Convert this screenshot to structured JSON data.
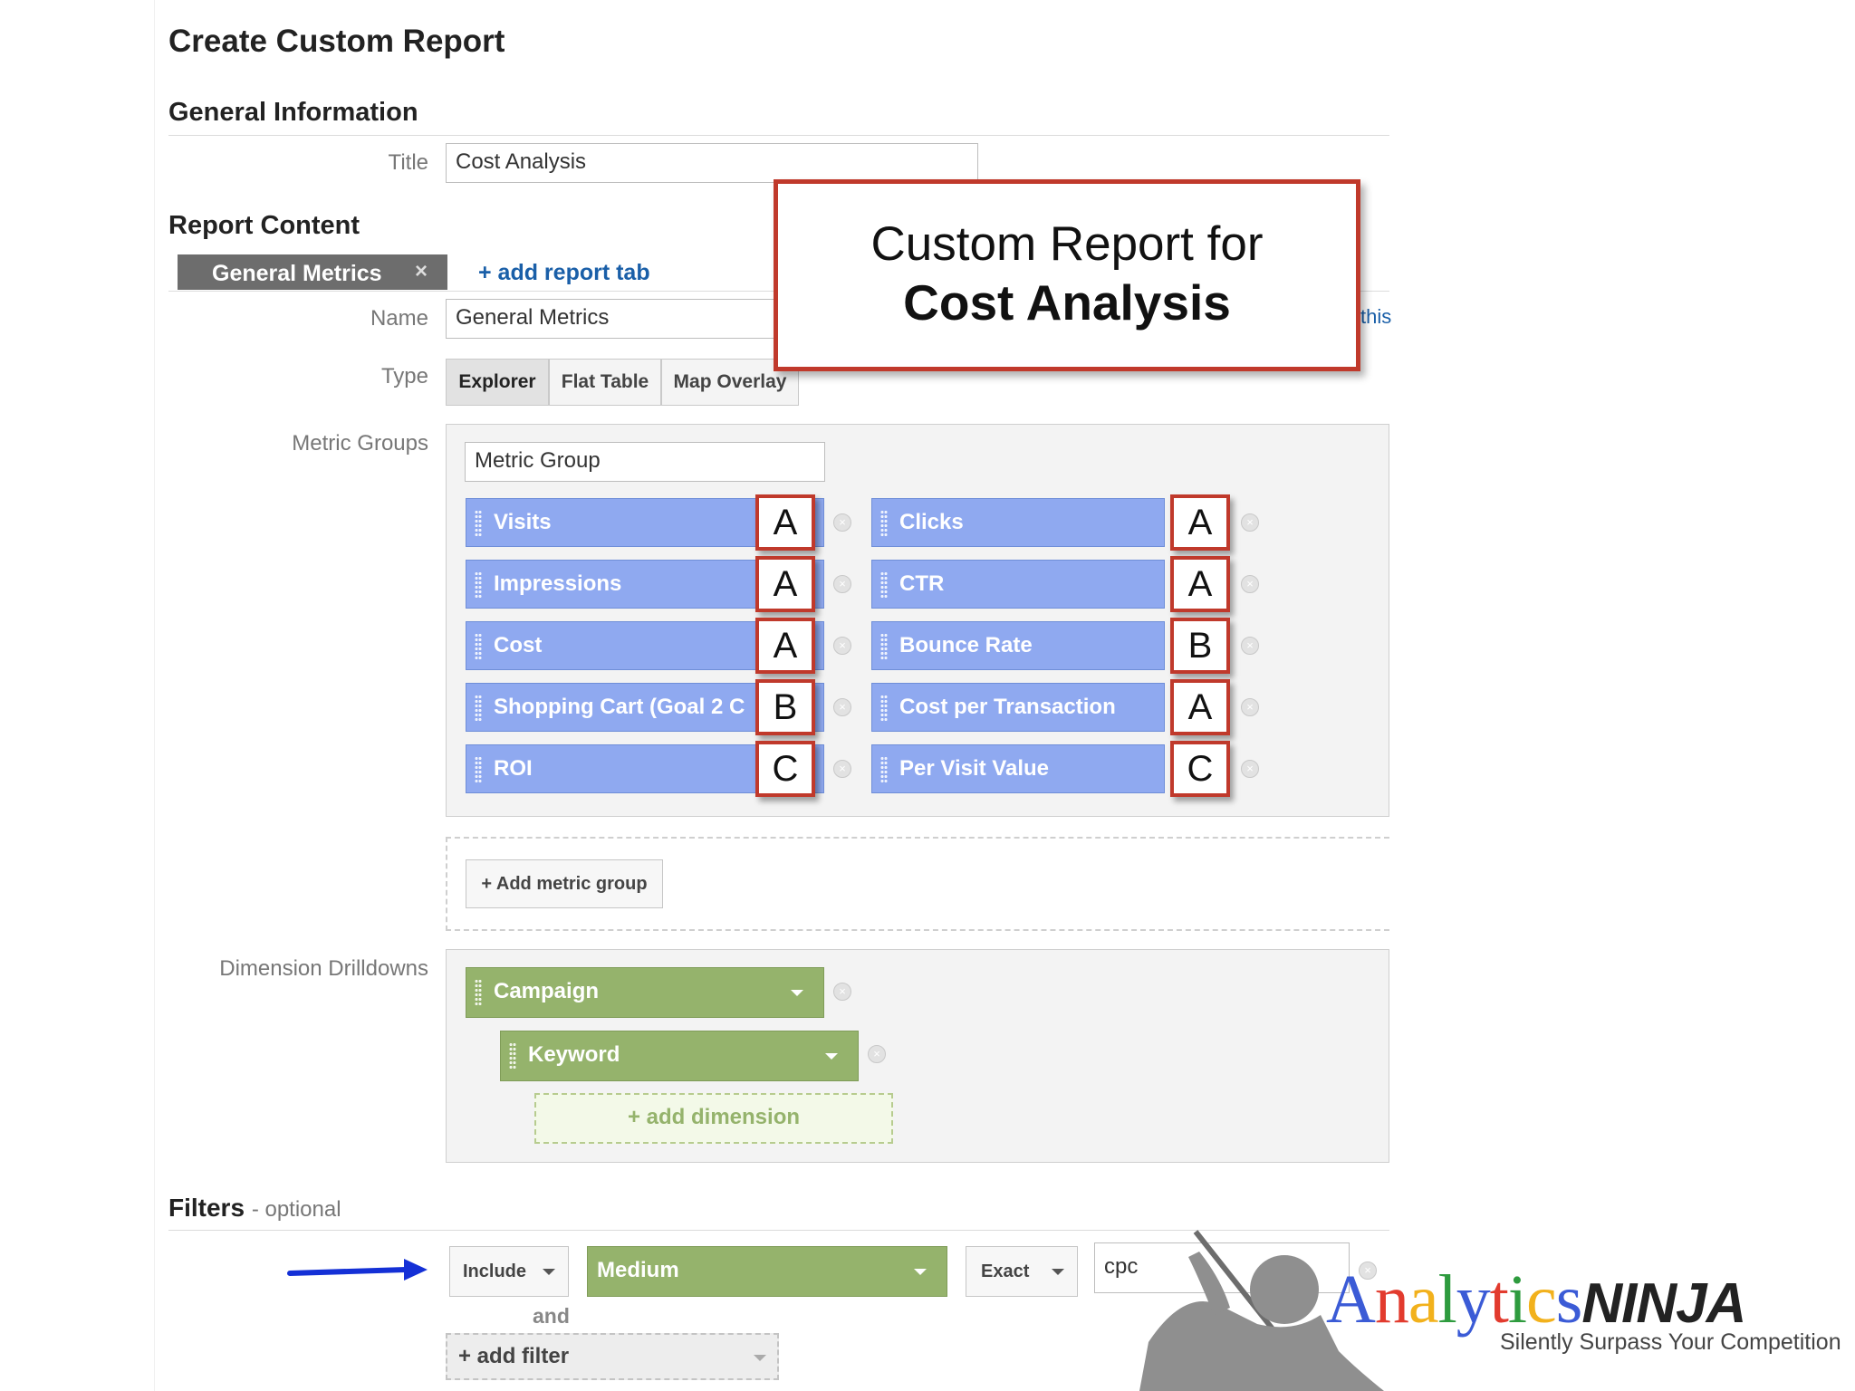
{
  "page_title": "Create Custom Report",
  "general_info": {
    "heading": "General Information",
    "title_label": "Title",
    "title_value": "Cost Analysis"
  },
  "report_content": {
    "heading": "Report Content",
    "tab_label": "General Metrics",
    "tab_close": "×",
    "add_tab": "+ add report tab",
    "name_label": "Name",
    "name_value": "General Metrics",
    "name_trailing_link": "this",
    "type_label": "Type",
    "type_options": [
      "Explorer",
      "Flat Table",
      "Map Overlay"
    ],
    "type_selected": "Explorer",
    "metric_groups_label": "Metric Groups",
    "metric_group_name": "Metric Group",
    "metrics_left": [
      {
        "label": "Visits",
        "grade": "A"
      },
      {
        "label": "Impressions",
        "grade": "A"
      },
      {
        "label": "Cost",
        "grade": "A"
      },
      {
        "label": "Shopping Cart (Goal 2 C",
        "grade": "B"
      },
      {
        "label": "ROI",
        "grade": "C"
      }
    ],
    "metrics_right": [
      {
        "label": "Clicks",
        "grade": "A"
      },
      {
        "label": "CTR",
        "grade": "A"
      },
      {
        "label": "Bounce Rate",
        "grade": "B"
      },
      {
        "label": "Cost per Transaction",
        "grade": "A"
      },
      {
        "label": "Per Visit Value",
        "grade": "C"
      }
    ],
    "add_metric_group": "+ Add metric group",
    "dimension_label": "Dimension Drilldowns",
    "dimensions": [
      "Campaign",
      "Keyword"
    ],
    "add_dimension": "+ add dimension"
  },
  "filters": {
    "heading": "Filters",
    "optional": "- optional",
    "include": "Include",
    "dimension": "Medium",
    "match": "Exact",
    "value": "cpc",
    "and": "and",
    "add_filter": "+ add filter"
  },
  "callout": {
    "line1": "Custom Report for",
    "line2": "Cost Analysis"
  },
  "logo": {
    "name": "AnalyticsNINJA",
    "tagline": "Silently Surpass Your Competition",
    "colors": [
      "#3b5bd6",
      "#e23b2e",
      "#f2b11c",
      "#2e9b3e",
      "#3b5bd6",
      "#e23b2e",
      "#2e9b3e",
      "#f2b11c",
      "#3b5bd6"
    ]
  },
  "colors": {
    "metric_fill": "#8fa9f0",
    "dimension_fill": "#95b36c",
    "badge_border": "#c0392b",
    "link": "#1a5fa8",
    "arrow": "#1430d6"
  }
}
